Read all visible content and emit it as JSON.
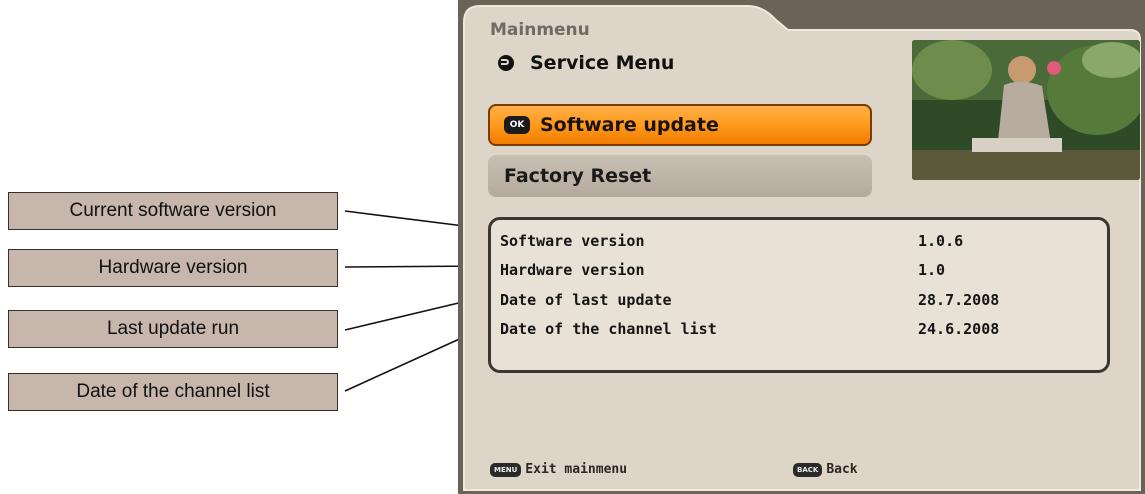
{
  "breadcrumb": "Mainmenu",
  "section_title": "Service Menu",
  "menu": {
    "items": [
      {
        "label": "Software update",
        "key_badge": "OK",
        "selected": true
      },
      {
        "label": "Factory Reset",
        "selected": false
      }
    ]
  },
  "info": {
    "rows": [
      {
        "key": "Software version",
        "value": "1.0.6"
      },
      {
        "key": "Hardware version",
        "value": "1.0"
      },
      {
        "key": "Date of last update",
        "value": "28.7.2008"
      },
      {
        "key": "Date of the channel list",
        "value": "24.6.2008"
      }
    ]
  },
  "footer": {
    "exit_key": "MENU",
    "exit_label": "Exit mainmenu",
    "back_key": "BACK",
    "back_label": "Back"
  },
  "callouts": [
    "Current software version",
    "Hardware version",
    "Last update run",
    "Date of the channel list"
  ],
  "colors": {
    "panel_bg": "#ddd5c8",
    "highlight": "#ff9a1a",
    "callout_bg": "#c7b6ab"
  }
}
